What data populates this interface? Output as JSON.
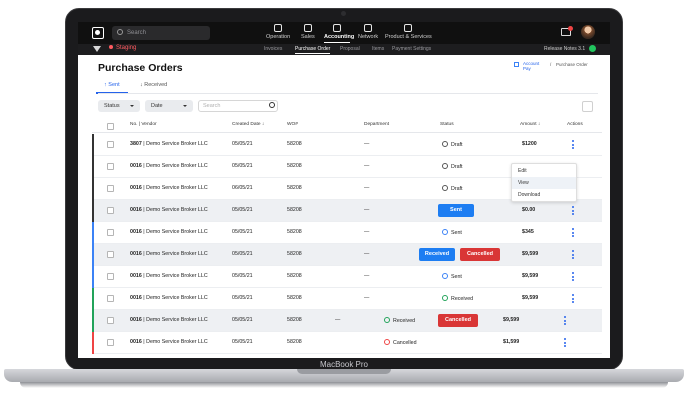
{
  "device": {
    "label": "MacBook Pro"
  },
  "topbar": {
    "search_placeholder": "Search",
    "modules": [
      "Operation",
      "Sales",
      "Accounting",
      "Network",
      "Product & Services"
    ],
    "active_module_index": 2
  },
  "subbar": {
    "environment": "Staging",
    "tabs": [
      "Invoices",
      "Purchase Order",
      "Proposal",
      "Items",
      "Payment Settings"
    ],
    "active_tab_index": 1,
    "release_notes": "Release Notes 3.1"
  },
  "page": {
    "title": "Purchase Orders",
    "breadcrumb": {
      "parent": "Account Pay",
      "current": "Purchase Order"
    }
  },
  "tabs": {
    "sent": "Sent",
    "received": "Received"
  },
  "filters": {
    "status": "Status",
    "date": "Date",
    "search_placeholder": "Search"
  },
  "table": {
    "headers": {
      "no": "No. | Vendor",
      "created": "Created Date ↓",
      "wo": "WO#",
      "department": "Department",
      "status": "Status",
      "amount": "Amount ↓",
      "actions": "Actions"
    },
    "rows": [
      {
        "no": "3807",
        "vendor": "Demo Service Broker LLC",
        "date": "05/05/21",
        "wo": "58208",
        "dept": "—",
        "status": "Draft",
        "amount": "$1200"
      },
      {
        "no": "0016",
        "vendor": "Demo Service Broker LLC",
        "date": "05/05/21",
        "wo": "58208",
        "dept": "—",
        "status": "Draft",
        "amount": ""
      },
      {
        "no": "0016",
        "vendor": "Demo Service Broker LLC",
        "date": "06/05/21",
        "wo": "58208",
        "dept": "—",
        "status": "Draft",
        "amount": ""
      },
      {
        "no": "0016",
        "vendor": "Demo Service Broker LLC",
        "date": "05/05/21",
        "wo": "58208",
        "dept": "—",
        "status_button": "Sent",
        "amount": "$0.00"
      },
      {
        "no": "0016",
        "vendor": "Demo Service Broker LLC",
        "date": "05/05/21",
        "wo": "58208",
        "dept": "—",
        "status": "Sent",
        "amount": "$345"
      },
      {
        "no": "0016",
        "vendor": "Demo Service Broker LLC",
        "date": "05/05/21",
        "wo": "58208",
        "dept": "—",
        "status_button": "Received",
        "action_button": "Cancelled",
        "amount": "$9,599"
      },
      {
        "no": "0016",
        "vendor": "Demo Service Broker LLC",
        "date": "05/05/21",
        "wo": "58208",
        "dept": "—",
        "status": "Sent",
        "amount": "$9,599"
      },
      {
        "no": "0016",
        "vendor": "Demo Service Broker LLC",
        "date": "05/05/21",
        "wo": "58208",
        "dept": "—",
        "status": "Received",
        "amount": "$9,599"
      },
      {
        "no": "0016",
        "vendor": "Demo Service Broker LLC",
        "date": "05/05/21",
        "wo": "58208",
        "dept": "—",
        "status": "Received",
        "action_button": "Cancelled",
        "amount": "$9,599"
      },
      {
        "no": "0016",
        "vendor": "Demo Service Broker LLC",
        "date": "05/05/21",
        "wo": "58208",
        "dept": "—",
        "status": "Cancelled",
        "amount": "$1,599"
      }
    ]
  },
  "action_menu": [
    "Edit",
    "View",
    "Download"
  ],
  "colors": {
    "accent_blue": "#1d7df2",
    "cancel_red": "#d93636",
    "received_green": "#22a35a",
    "staging_red": "#ff5a5f"
  }
}
